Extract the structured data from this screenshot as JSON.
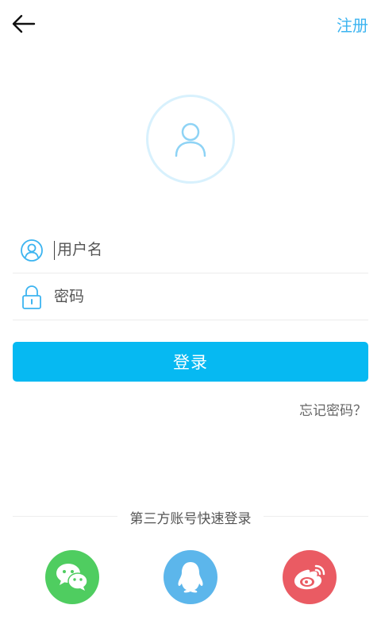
{
  "header": {
    "register_label": "注册"
  },
  "login_form": {
    "username_placeholder": "用户名",
    "password_placeholder": "密码",
    "login_button_label": "登录",
    "forgot_password_label": "忘记密码？"
  },
  "third_party": {
    "label": "第三方账号快速登录",
    "providers": [
      {
        "name": "wechat",
        "icon": "wechat-icon",
        "color": "#4fcd60"
      },
      {
        "name": "qq",
        "icon": "qq-icon",
        "color": "#5cb6eb"
      },
      {
        "name": "weibo",
        "icon": "weibo-icon",
        "color": "#ea5b63"
      }
    ]
  },
  "colors": {
    "accent": "#06b9f2",
    "link": "#3cb4f0"
  }
}
